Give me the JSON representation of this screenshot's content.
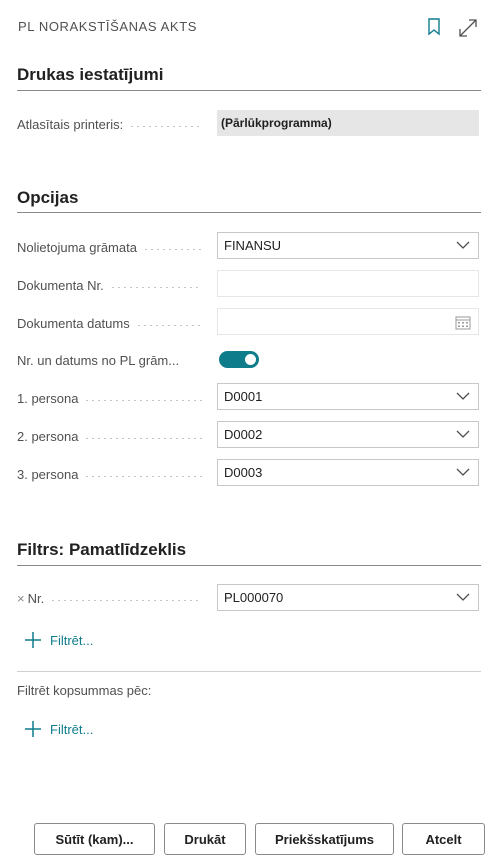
{
  "header": {
    "title": "PL NORAKSTĪŠANAS AKTS",
    "bookmark_icon": "bookmark-icon",
    "expand_icon": "expand-icon"
  },
  "print_settings": {
    "title": "Drukas iestatījumi",
    "printer_label": "Atlasītais printeris:",
    "printer_value": "(Pārlūkprogramma)"
  },
  "options": {
    "title": "Opcijas",
    "journal_label": "Nolietojuma grāmata",
    "journal_value": "FINANSU",
    "doc_no_label": "Dokumenta Nr.",
    "doc_no_value": "",
    "doc_date_label": "Dokumenta datums",
    "doc_date_value": "",
    "toggle_label": "Nr. un datums no PL grām...",
    "toggle_on": true,
    "person1_label": "1. persona",
    "person1_value": "D0001",
    "person2_label": "2. persona",
    "person2_value": "D0002",
    "person3_label": "3. persona",
    "person3_value": "D0003"
  },
  "filter": {
    "title": "Filtrs: Pamatlīdzeklis",
    "remove_icon": "×",
    "nr_label": "Nr.",
    "nr_value": "PL000070",
    "add_filter": "Filtrēt...",
    "totals_label": "Filtrēt kopsummas pēc:",
    "add_totals_filter": "Filtrēt..."
  },
  "footer": {
    "send_label": "Sūtīt (kam)...",
    "print_label": "Drukāt",
    "preview_label": "Priekšskatījums",
    "cancel_label": "Atcelt"
  },
  "colors": {
    "accent": "#0f7c8c"
  }
}
